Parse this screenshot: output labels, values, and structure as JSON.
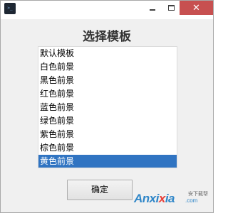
{
  "titlebar": {
    "app_icon": "app-icon",
    "minimize_icon": "minimize-icon",
    "maximize_icon": "maximize-icon",
    "close_icon": "close-icon",
    "close_color": "#c75050"
  },
  "dialog": {
    "title": "选择模板",
    "templates": [
      {
        "label": "默认模板",
        "selected": false
      },
      {
        "label": "白色前景",
        "selected": false
      },
      {
        "label": "黑色前景",
        "selected": false
      },
      {
        "label": "红色前景",
        "selected": false
      },
      {
        "label": "蓝色前景",
        "selected": false
      },
      {
        "label": "绿色前景",
        "selected": false
      },
      {
        "label": "紫色前景",
        "selected": false
      },
      {
        "label": "棕色前景",
        "selected": false
      },
      {
        "label": "黄色前景",
        "selected": true
      }
    ],
    "selection_color": "#3074c2",
    "ok_label": "确定"
  },
  "watermark": {
    "brand_prefix": "Anxi",
    "brand_x": "x",
    "brand_suffix": "ia",
    "domain": ".com",
    "sub": "安下载帮"
  }
}
